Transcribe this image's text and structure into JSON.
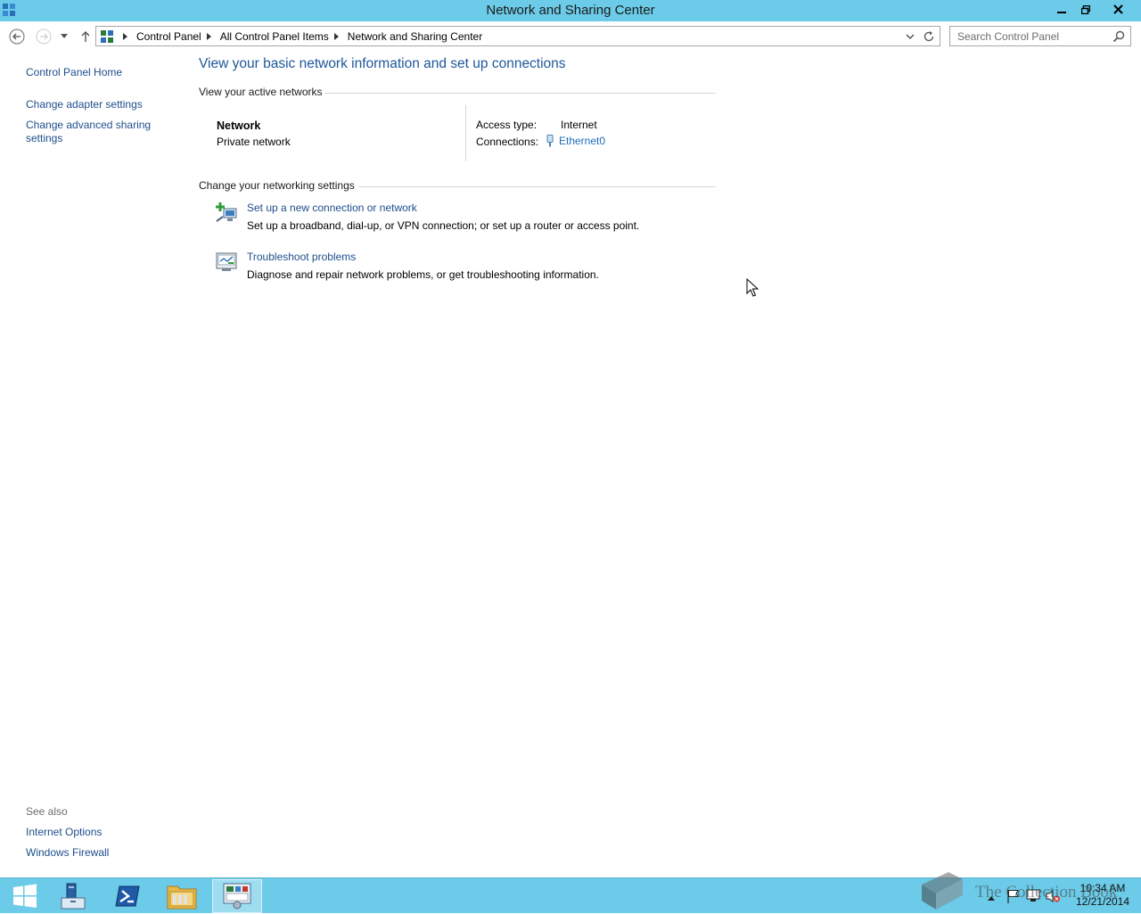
{
  "window": {
    "title": "Network and Sharing Center"
  },
  "navigation": {
    "breadcrumb": [
      "Control Panel",
      "All Control Panel Items",
      "Network and Sharing Center"
    ],
    "search_placeholder": "Search Control Panel"
  },
  "sidebar": {
    "items": [
      {
        "label": "Control Panel Home"
      },
      {
        "label": "Change adapter settings"
      },
      {
        "label": "Change advanced sharing settings"
      }
    ],
    "see_also_heading": "See also",
    "see_also": [
      {
        "label": "Internet Options"
      },
      {
        "label": "Windows Firewall"
      }
    ]
  },
  "main": {
    "title": "View your basic network information and set up connections",
    "active_networks": {
      "heading": "View your active networks",
      "network_name": "Network",
      "network_type": "Private network",
      "access_type_label": "Access type:",
      "access_type_value": "Internet",
      "connections_label": "Connections:",
      "connections_value": "Ethernet0"
    },
    "networking_settings": {
      "heading": "Change your networking settings",
      "tasks": [
        {
          "icon": "new-connection-icon",
          "link": "Set up a new connection or network",
          "description": "Set up a broadband, dial-up, or VPN connection; or set up a router or access point."
        },
        {
          "icon": "troubleshoot-icon",
          "link": "Troubleshoot problems",
          "description": "Diagnose and repair network problems, or get troubleshooting information."
        }
      ]
    }
  },
  "taskbar": {
    "apps": [
      "start-button",
      "server-manager",
      "powershell",
      "file-explorer",
      "control-panel"
    ],
    "clock_time": "10:34 AM",
    "clock_date": "12/21/2014"
  },
  "watermark": {
    "text": "The Collection Book"
  },
  "colors": {
    "chrome": "#6bcbe8",
    "link": "#1e4e8c",
    "title": "#1e5799"
  }
}
